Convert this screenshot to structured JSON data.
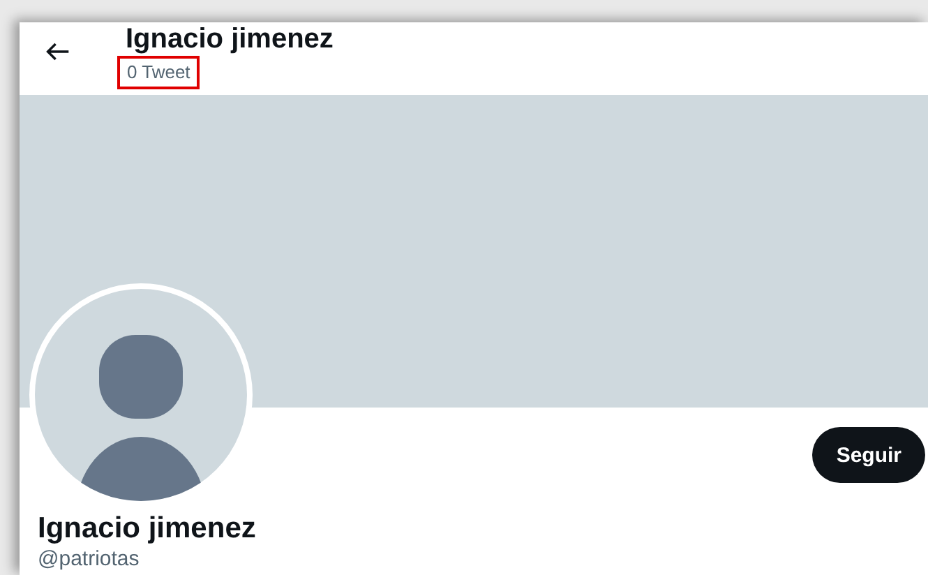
{
  "header": {
    "name": "Ignacio jimenez",
    "tweet_count": "0 Tweet",
    "tweet_count_highlighted": true
  },
  "banner": {
    "kind": "empty"
  },
  "profile": {
    "follow_button": "Seguir",
    "name": "Ignacio jimenez",
    "handle": "@patriotas"
  }
}
